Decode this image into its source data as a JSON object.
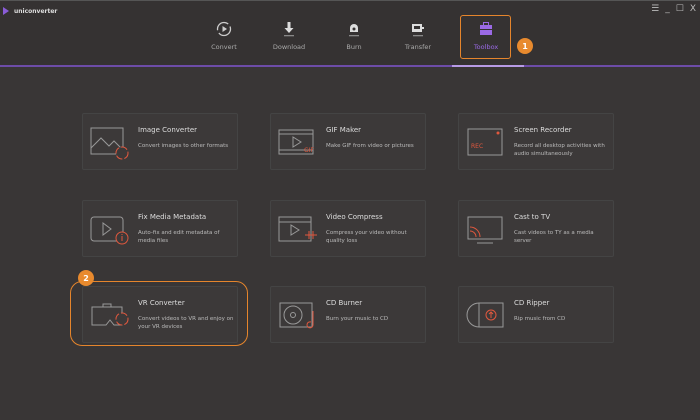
{
  "app": {
    "title": "uniconverter"
  },
  "window": {
    "menu": "☰",
    "minimize": "_",
    "maximize": "☐",
    "close": "X"
  },
  "nav": [
    {
      "label": "Convert"
    },
    {
      "label": "Download"
    },
    {
      "label": "Burn"
    },
    {
      "label": "Transfer"
    },
    {
      "label": "Toolbox",
      "active": true
    }
  ],
  "badges": [
    "1",
    "2"
  ],
  "accent": "#8a5cd8",
  "highlight": "#e5852c",
  "icon_accent": "#e0583e",
  "tools": [
    {
      "title": "Image Converter",
      "desc": "Convert images to other formats",
      "icon": "image-convert-icon"
    },
    {
      "title": "GIF Maker",
      "desc": "Make GIF from video or pictures",
      "icon": "gif-icon",
      "tag": "GIF"
    },
    {
      "title": "Screen Recorder",
      "desc": "Record all desktop activities with audio simultaneously",
      "icon": "screen-record-icon",
      "tag": "REC"
    },
    {
      "title": "Fix Media Metadata",
      "desc": "Auto-fix and edit metadata of media files",
      "icon": "metadata-icon"
    },
    {
      "title": "Video Compress",
      "desc": "Compress your video without quality loss",
      "icon": "compress-icon"
    },
    {
      "title": "Cast to TV",
      "desc": "Cast videos to TY as a media server",
      "icon": "cast-icon"
    },
    {
      "title": "VR Converter",
      "desc": "Convert videos to VR and enjoy on your VR devices",
      "icon": "vr-icon"
    },
    {
      "title": "CD Burner",
      "desc": "Burn your music to CD",
      "icon": "cd-burn-icon"
    },
    {
      "title": "CD Ripper",
      "desc": "Rip music from CD",
      "icon": "cd-rip-icon"
    }
  ]
}
